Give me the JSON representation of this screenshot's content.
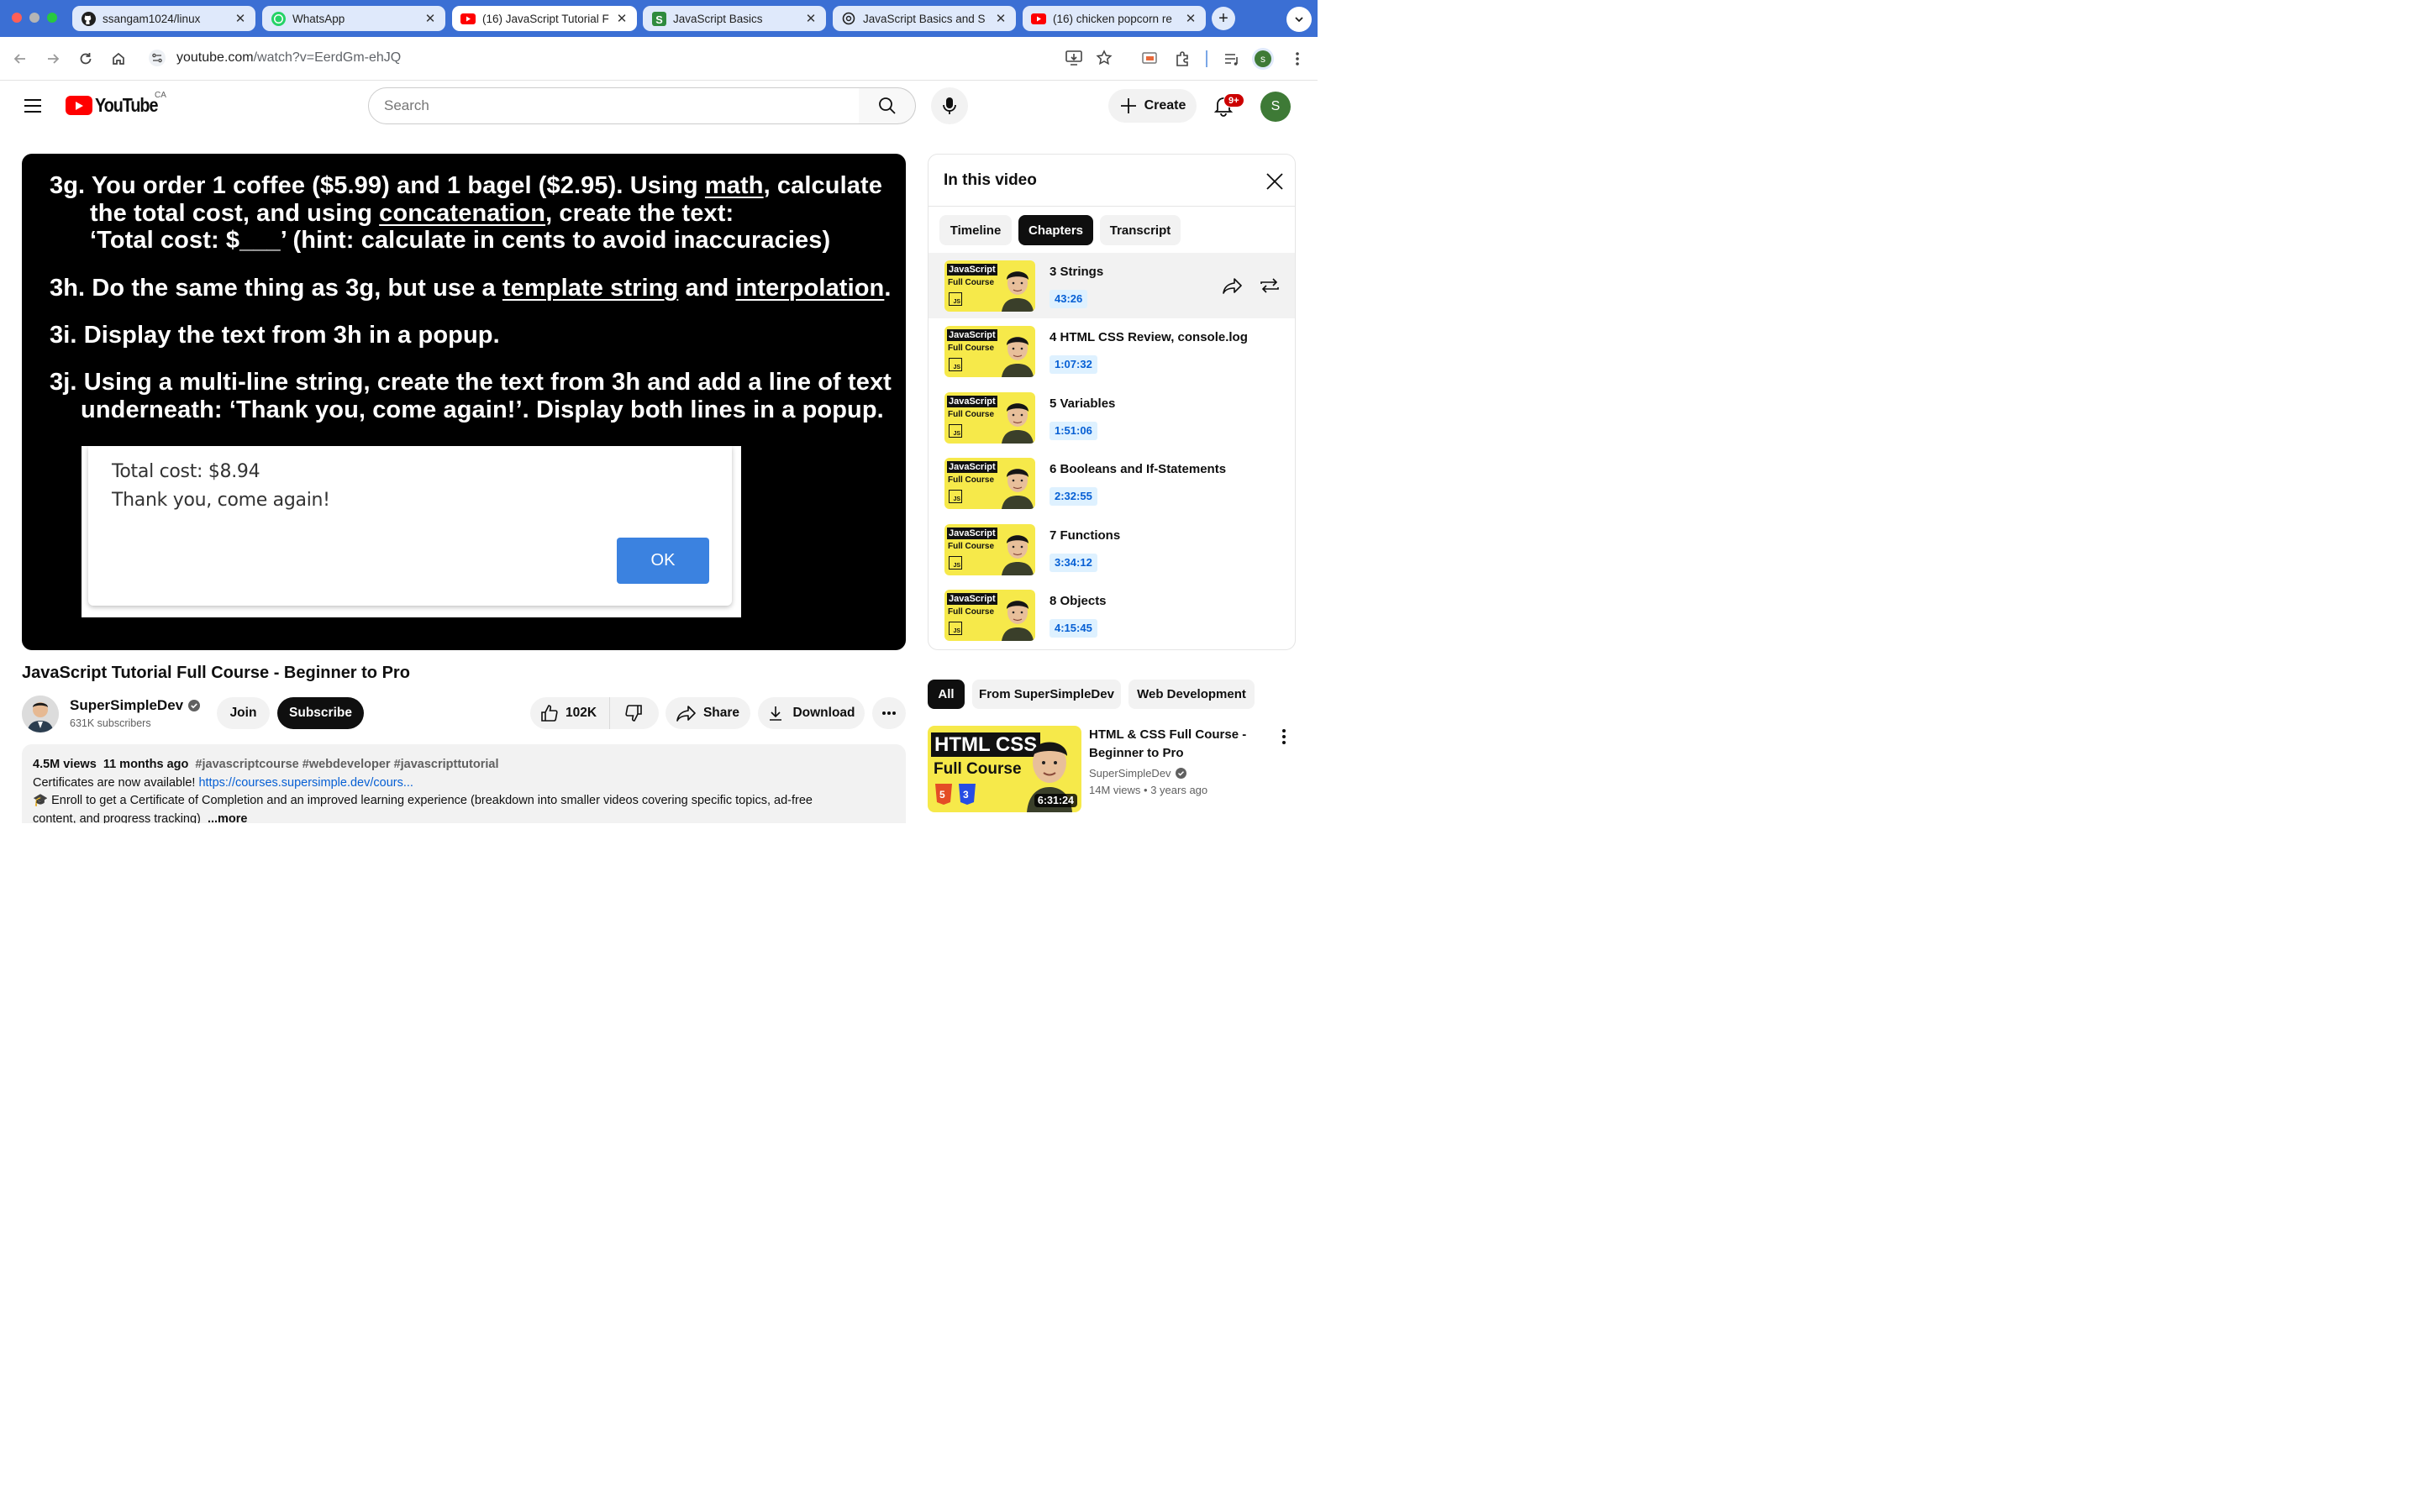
{
  "browser": {
    "tabs": [
      {
        "title": "ssangam1024/linux",
        "icon": "github-icon"
      },
      {
        "title": "WhatsApp",
        "icon": "whatsapp-icon"
      },
      {
        "title": "(16) JavaScript Tutorial F",
        "icon": "youtube-icon",
        "active": true
      },
      {
        "title": "JavaScript Basics",
        "icon": "supersimple-icon"
      },
      {
        "title": "JavaScript Basics and S",
        "icon": "chatgpt-icon"
      },
      {
        "title": "(16) chicken popcorn re",
        "icon": "youtube-icon"
      }
    ],
    "url_host": "youtube.com",
    "url_path": "/watch?v=EerdGm-ehJQ",
    "profile_initial": "s"
  },
  "header": {
    "logo_text": "YouTube",
    "region": "CA",
    "search_placeholder": "Search",
    "create_label": "Create",
    "notification_badge": "9+",
    "avatar_initial": "S"
  },
  "player": {
    "slide_lines": [
      [
        "3g. You order 1 coffee ($5.99) and 1 bagel ($2.95). Using ",
        "math",
        ", calculate"
      ],
      [
        "the total cost, and using ",
        "concatenation",
        ", create the text:"
      ],
      [
        "‘Total cost: $___’ (hint: calculate in cents to avoid inaccuracies)"
      ],
      [
        "3h. Do the same thing as 3g, but use a ",
        "template string",
        " and ",
        "interpolation",
        "."
      ],
      [
        "3i. Display the text from 3h in a popup."
      ],
      [
        "3j. Using a multi-line string, create the text from 3h and add a line of text"
      ],
      [
        "underneath: ‘Thank you, come again!’. Display both lines in a popup."
      ]
    ],
    "popup": {
      "line1": "Total cost: $8.94",
      "line2": "Thank you, come again!",
      "ok_label": "OK"
    }
  },
  "video": {
    "title": "JavaScript Tutorial Full Course - Beginner to Pro",
    "channel": "SuperSimpleDev",
    "subscribers": "631K subscribers",
    "join_label": "Join",
    "subscribe_label": "Subscribe",
    "likes": "102K",
    "share_label": "Share",
    "download_label": "Download"
  },
  "description": {
    "views": "4.5M views",
    "age": "11 months ago",
    "hashtags": "#javascriptcourse #webdeveloper #javascripttutorial",
    "line2_text": "Certificates are now available! ",
    "line2_link": "https://courses.supersimple.dev/cours...",
    "line3": "🎓 Enroll to get a Certificate of Completion and an improved learning experience (breakdown into smaller videos covering specific topics, ad-free",
    "line4": "content, and progress tracking)",
    "more_label": "...more"
  },
  "panel": {
    "title": "In this video",
    "tabs": [
      "Timeline",
      "Chapters",
      "Transcript"
    ],
    "active_tab": "Chapters",
    "thumb_title": "JavaScript",
    "thumb_sub": "Full Course",
    "thumb_badge": "JS",
    "chapters": [
      {
        "label": "3 Strings",
        "time": "43:26"
      },
      {
        "label": "4 HTML CSS Review, console.log",
        "time": "1:07:32"
      },
      {
        "label": "5 Variables",
        "time": "1:51:06"
      },
      {
        "label": "6 Booleans and If-Statements",
        "time": "2:32:55"
      },
      {
        "label": "7 Functions",
        "time": "3:34:12"
      },
      {
        "label": "8 Objects",
        "time": "4:15:45"
      }
    ]
  },
  "related": {
    "chips": [
      "All",
      "From SuperSimpleDev",
      "Web Development"
    ],
    "item": {
      "thumb_line1": "HTML CSS",
      "thumb_line2": "Full Course",
      "duration": "6:31:24",
      "title": "HTML & CSS Full Course - Beginner to Pro",
      "channel": "SuperSimpleDev",
      "views": "14M views",
      "age": "3 years ago"
    }
  }
}
